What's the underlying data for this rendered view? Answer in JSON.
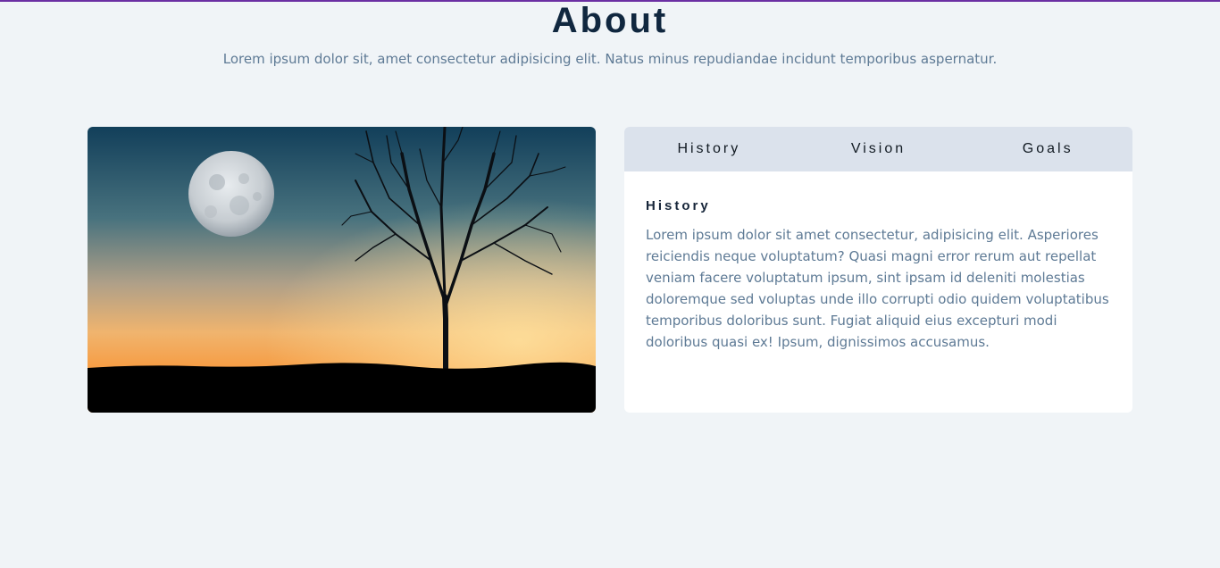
{
  "header": {
    "title": "About",
    "subtitle": "Lorem ipsum dolor sit, amet consectetur adipisicing elit. Natus minus repudiandae incidunt temporibus aspernatur."
  },
  "tabs": [
    {
      "label": "History",
      "active": true
    },
    {
      "label": "Vision",
      "active": false
    },
    {
      "label": "Goals",
      "active": false
    }
  ],
  "content": {
    "heading": "History",
    "body": "Lorem ipsum dolor sit amet consectetur, adipisicing elit. Asperiores reiciendis neque voluptatum? Quasi magni error rerum aut repellat veniam facere voluptatum ipsum, sint ipsam id deleniti molestias doloremque sed voluptas unde illo corrupti odio quidem voluptatibus temporibus doloribus sunt. Fugiat aliquid eius excepturi modi doloribus quasi ex! Ipsum, dignissimos accusamus."
  },
  "colors": {
    "accent_line": "#6b2fa3",
    "title": "#10273f",
    "muted_text": "#5e7a95",
    "tab_bar": "#dbe2ec",
    "background": "#f0f4f7"
  }
}
